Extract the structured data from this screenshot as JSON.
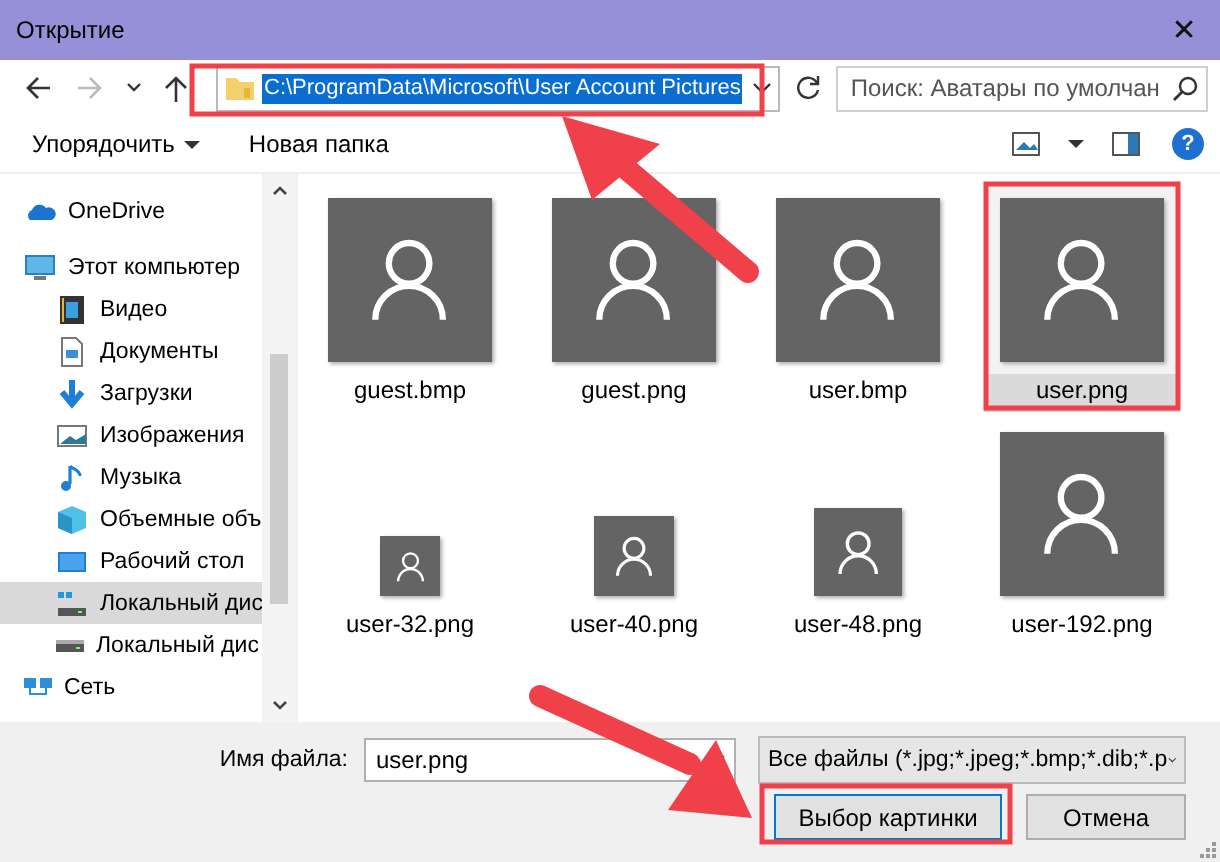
{
  "window": {
    "title": "Открытие",
    "close": "✕"
  },
  "navigation": {
    "address": "C:\\ProgramData\\Microsoft\\User Account Pictures",
    "search": {
      "placeholder": "Поиск: Аватары по умолчан"
    }
  },
  "toolbar": {
    "organize": "Упорядочить",
    "new_folder": "Новая папка",
    "help": "?"
  },
  "sidebar": {
    "items": [
      {
        "label": "OneDrive",
        "kind": "cloud",
        "selected": false
      },
      {
        "label": "Этот компьютер",
        "kind": "computer",
        "selected": false,
        "children": [
          {
            "label": "Видео",
            "kind": "video",
            "selected": false
          },
          {
            "label": "Документы",
            "kind": "documents",
            "selected": false
          },
          {
            "label": "Загрузки",
            "kind": "downloads",
            "selected": false
          },
          {
            "label": "Изображения",
            "kind": "pictures",
            "selected": false
          },
          {
            "label": "Музыка",
            "kind": "music",
            "selected": false
          },
          {
            "label": "Объемные объ",
            "kind": "objects",
            "selected": false
          },
          {
            "label": "Рабочий стол",
            "kind": "desktop",
            "selected": false
          },
          {
            "label": "Локальный дис",
            "kind": "system-disk",
            "selected": true
          },
          {
            "label": "Локальный дис",
            "kind": "disk",
            "selected": false
          }
        ]
      },
      {
        "label": "Сеть",
        "kind": "network",
        "selected": false
      }
    ]
  },
  "files": [
    {
      "name": "guest.bmp",
      "kind": "large",
      "selected": false
    },
    {
      "name": "guest.png",
      "kind": "large",
      "selected": false
    },
    {
      "name": "user.bmp",
      "kind": "large",
      "selected": false
    },
    {
      "name": "user.png",
      "kind": "large",
      "selected": true
    },
    {
      "name": "user-32.png",
      "kind": "tiny",
      "selected": false
    },
    {
      "name": "user-40.png",
      "kind": "small",
      "selected": false
    },
    {
      "name": "user-48.png",
      "kind": "medium",
      "selected": false
    },
    {
      "name": "user-192.png",
      "kind": "huge",
      "selected": false
    }
  ],
  "footer": {
    "file_name_label": "Имя файла:",
    "file_name": "user.png",
    "filter": "Все файлы (*.jpg;*.jpeg;*.bmp;*.dib;*.p",
    "buttons": [
      {
        "label": "Выбор картинки",
        "kind": "primary"
      },
      {
        "label": "Отмена",
        "kind": "cancel"
      }
    ]
  }
}
